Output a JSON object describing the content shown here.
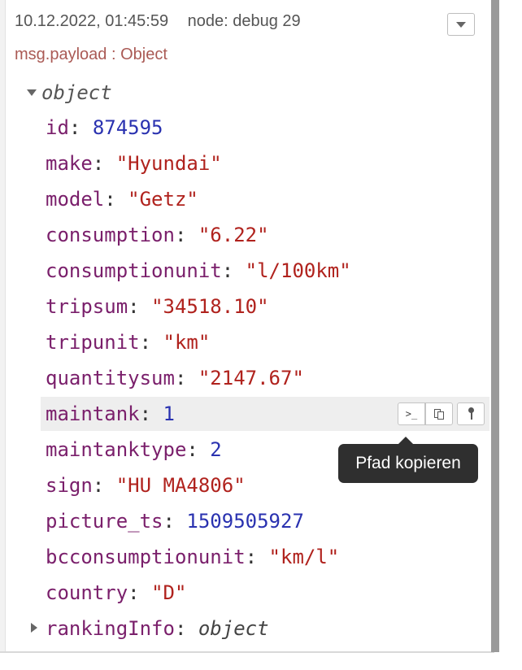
{
  "header": {
    "timestamp": "10.12.2022, 01:45:59",
    "node": "node: debug 29",
    "path": "msg.payload : Object"
  },
  "tree": {
    "root_type": "object",
    "props": [
      {
        "key": "id",
        "value": "874595",
        "kind": "num"
      },
      {
        "key": "make",
        "value": "\"Hyundai\"",
        "kind": "str"
      },
      {
        "key": "model",
        "value": "\"Getz\"",
        "kind": "str"
      },
      {
        "key": "consumption",
        "value": "\"6.22\"",
        "kind": "str"
      },
      {
        "key": "consumptionunit",
        "value": "\"l/100km\"",
        "kind": "str"
      },
      {
        "key": "tripsum",
        "value": "\"34518.10\"",
        "kind": "str"
      },
      {
        "key": "tripunit",
        "value": "\"km\"",
        "kind": "str"
      },
      {
        "key": "quantitysum",
        "value": "\"2147.67\"",
        "kind": "str"
      },
      {
        "key": "maintank",
        "value": "1",
        "kind": "num"
      },
      {
        "key": "maintanktype",
        "value": "2",
        "kind": "num"
      },
      {
        "key": "sign",
        "value": "\"HU MA4806\"",
        "kind": "str"
      },
      {
        "key": "picture_ts",
        "value": "1509505927",
        "kind": "num"
      },
      {
        "key": "bcconsumptionunit",
        "value": "\"km/l\"",
        "kind": "str"
      },
      {
        "key": "country",
        "value": "\"D\"",
        "kind": "str"
      },
      {
        "key": "rankingInfo",
        "value": "object",
        "kind": "type"
      }
    ]
  },
  "tools": {
    "copy_path_glyph": ">_",
    "tooltip": "Pfad kopieren"
  }
}
